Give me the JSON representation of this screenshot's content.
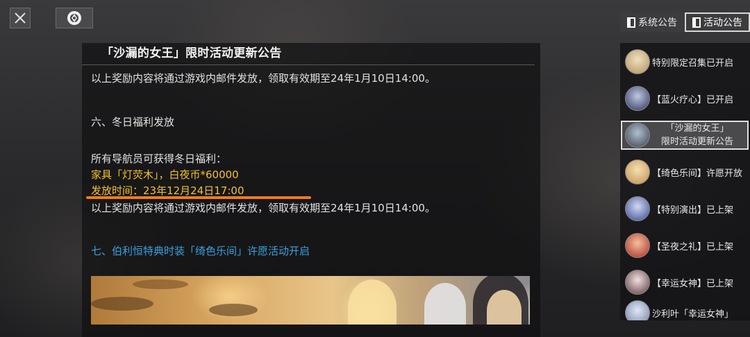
{
  "document": {
    "title": "「沙漏的女王」限时活动更新公告",
    "lines": {
      "reward_notice_1": "以上奖励内容将通过游戏内邮件发放，领取有效期至24年1月10日14:00。",
      "section_6_heading": "六、冬日福利发放",
      "benefit_intro": "所有导航员可获得冬日福利：",
      "benefit_items": "家具「灯荧木」，白夜币*60000",
      "release_time": "发放时间：23年12月24日17:00",
      "reward_notice_2": "以上奖励内容将通过游戏内邮件发放，领取有效期至24年1月10日14:00。",
      "section_7_heading": "七、伯利恒特典时装「绮色乐间」许愿活动开启"
    }
  },
  "tabs": {
    "system": "系统公告",
    "activity": "活动公告",
    "active": "activity"
  },
  "announcements": [
    {
      "label": "特别限定召集已开启",
      "avatar": "blonde-character-portrait",
      "color": "#d9c9a0"
    },
    {
      "label": "【蓝火疗心】已开启",
      "avatar": "dark-blue-character-portrait",
      "color": "#3a4a7a"
    },
    {
      "label": "「沙漏的女王」限时活动更新公告",
      "avatar": "queen-character-portrait",
      "color": "#6a7a8a",
      "selected": true
    },
    {
      "label": "【绮色乐间】许愿开放",
      "avatar": "blonde-character-portrait",
      "color": "#e0c080"
    },
    {
      "label": "【特别演出】已上架",
      "avatar": "blue-hair-character-portrait",
      "color": "#4a5a9a"
    },
    {
      "label": "【圣夜之礼】已上架",
      "avatar": "red-hair-character-portrait",
      "color": "#c04030"
    },
    {
      "label": "【幸运女神】已上架",
      "avatar": "maid-character-portrait",
      "color": "#d0c0c0"
    },
    {
      "label": "沙利叶「幸运女神」",
      "avatar": "white-hair-character-portrait",
      "color": "#a0b0d0"
    }
  ],
  "icons": {
    "close": "close-icon",
    "logo": "game-logo-icon"
  },
  "colors": {
    "highlight_text": "#f2c230",
    "section_heading": "#3aa0de",
    "underline_mark": "#f07a1e"
  }
}
